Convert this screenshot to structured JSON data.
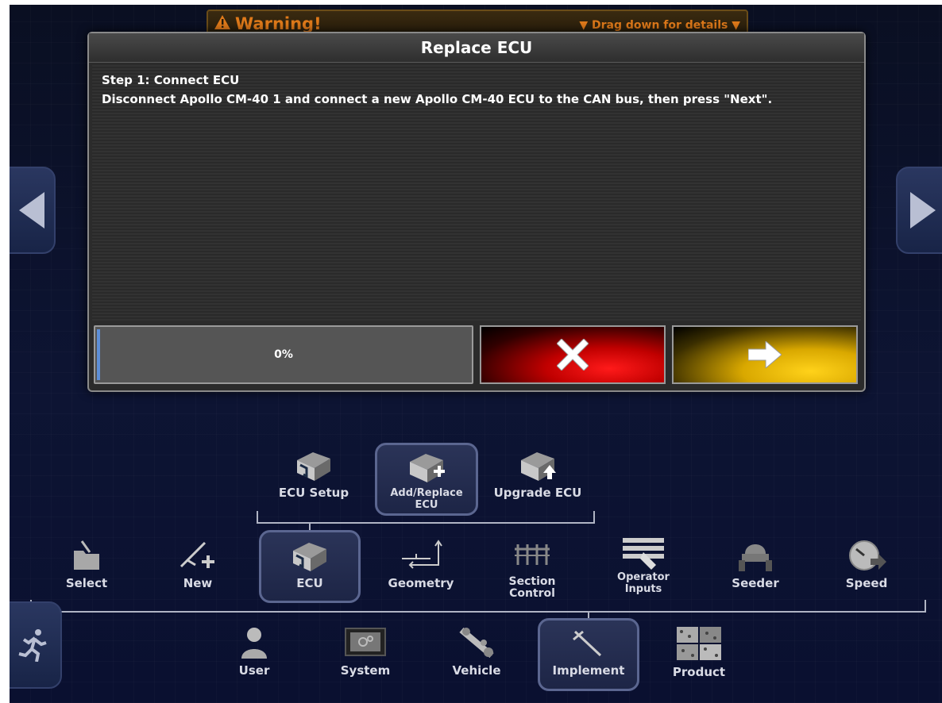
{
  "warning": {
    "title": "Warning!",
    "drag_hint": "▼ Drag down for details ▼"
  },
  "dialog": {
    "title": "Replace ECU",
    "step": "Step 1: Connect ECU",
    "instruction": "Disconnect Apollo CM-40 1 and connect a new Apollo CM-40 ECU to the CAN bus, then press \"Next\".",
    "progress_text": "0%",
    "progress_value": 0
  },
  "ecu_submenu": [
    {
      "label": "ECU Setup"
    },
    {
      "label": "Add/Replace ECU",
      "selected": true
    },
    {
      "label": "Upgrade ECU"
    }
  ],
  "implement_menu": [
    {
      "label": "Select"
    },
    {
      "label": "New"
    },
    {
      "label": "ECU",
      "selected": true
    },
    {
      "label": "Geometry"
    },
    {
      "label": "Section Control"
    },
    {
      "label": "Operator Inputs"
    },
    {
      "label": "Seeder"
    },
    {
      "label": "Speed"
    }
  ],
  "main_menu": [
    {
      "label": "User"
    },
    {
      "label": "System"
    },
    {
      "label": "Vehicle"
    },
    {
      "label": "Implement",
      "selected": true
    },
    {
      "label": "Product"
    }
  ],
  "colors": {
    "warning": "#e07a1a",
    "cancel": "#e00000",
    "next": "#f0c000",
    "selected_border": "#5b6690"
  }
}
